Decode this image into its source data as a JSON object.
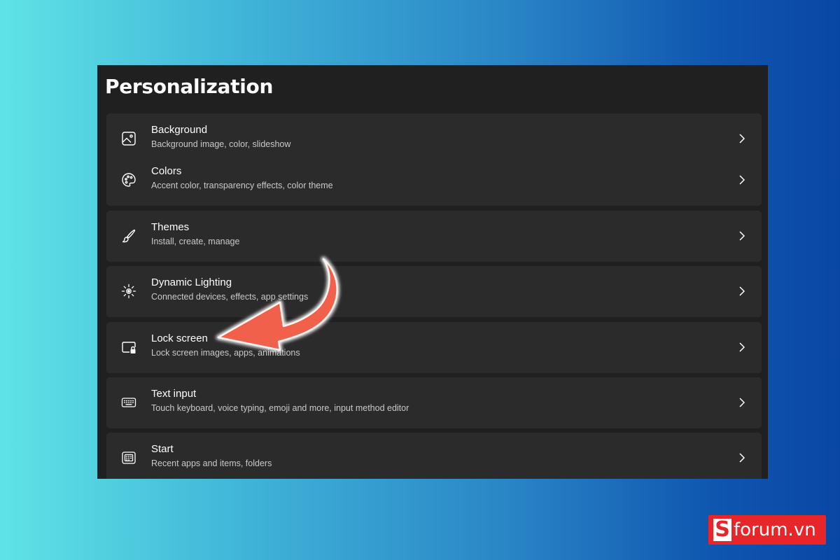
{
  "page": {
    "title": "Personalization"
  },
  "settings": [
    {
      "title": "Background",
      "desc": "Background image, color, slideshow",
      "icon": "image-icon"
    },
    {
      "title": "Colors",
      "desc": "Accent color, transparency effects, color theme",
      "icon": "palette-icon"
    },
    {
      "title": "Themes",
      "desc": "Install, create, manage",
      "icon": "brush-icon"
    },
    {
      "title": "Dynamic Lighting",
      "desc": "Connected devices, effects, app settings",
      "icon": "lighting-icon"
    },
    {
      "title": "Lock screen",
      "desc": "Lock screen images, apps, animations",
      "icon": "lock-screen-icon"
    },
    {
      "title": "Text input",
      "desc": "Touch keyboard, voice typing, emoji and more, input method editor",
      "icon": "keyboard-icon"
    },
    {
      "title": "Start",
      "desc": "Recent apps and items, folders",
      "icon": "start-icon"
    }
  ],
  "annotation": {
    "arrow_color": "#f0604a",
    "target": "Lock screen"
  },
  "watermark": {
    "brand_letter": "S",
    "brand_text": "forum.vn",
    "color": "#e8262a"
  }
}
